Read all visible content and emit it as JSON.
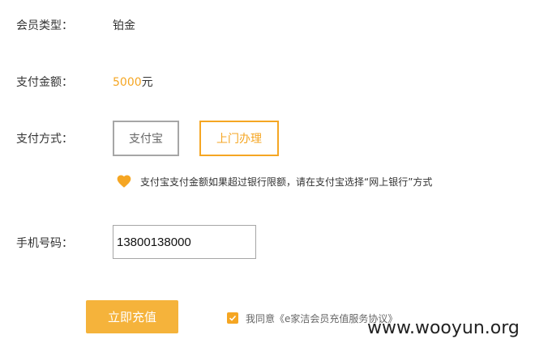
{
  "form": {
    "member_type_label": "会员类型：",
    "member_type_value": "铂金",
    "amount_label": "支付金额：",
    "amount_value": "5000",
    "amount_unit": "元",
    "pay_method_label": "支付方式：",
    "pay_methods": [
      "支付宝",
      "上门办理"
    ],
    "tip": "支付宝支付金额如果超过银行限额，请在支付宝选择“网上银行”方式",
    "phone_label": "手机号码：",
    "phone_value": "13800138000",
    "submit_label": "立即充值",
    "agree_text": "我同意《e家洁会员充值服务协议》"
  },
  "watermark": "www.wooyun.org",
  "colors": {
    "accent": "#f5a623",
    "button": "#f5b33b",
    "border": "#a6a6a6",
    "text": "#333333"
  },
  "icons": {
    "tip": "heart-icon",
    "agree": "checkbox-checked-icon"
  }
}
